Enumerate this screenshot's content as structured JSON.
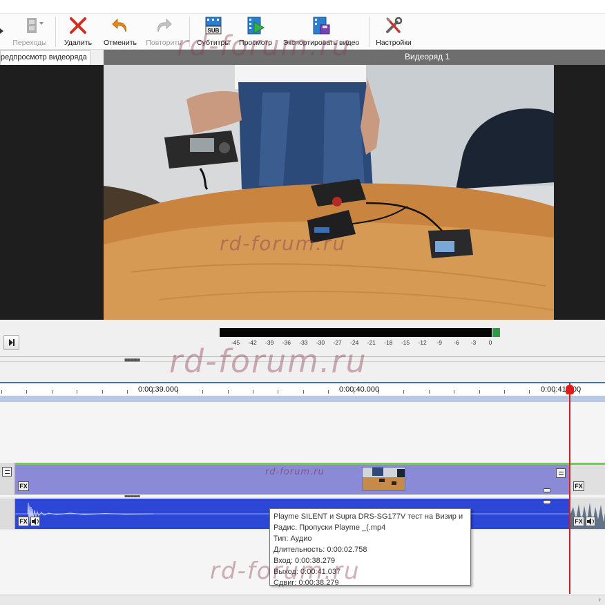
{
  "toolbar": {
    "transitions_label": "Переходы",
    "delete_label": "Удалить",
    "undo_label": "Отменить",
    "redo_label": "Повторить",
    "subtitles_label": "Субтитры",
    "subtitles_icon_text": "SUB",
    "preview_label": "Просмотр",
    "export_label": "Экспортировать видео",
    "settings_label": "Настройки"
  },
  "preview": {
    "tab_label": "редпросмотр видеоряда",
    "sequence_label": "Видеоряд 1"
  },
  "meter": {
    "ticks": [
      "-45",
      "-42",
      "-39",
      "-36",
      "-33",
      "-30",
      "-27",
      "-24",
      "-21",
      "-18",
      "-15",
      "-12",
      "-9",
      "-6",
      "-3",
      "0"
    ]
  },
  "timeline": {
    "ruler_labels": [
      "0:00:39.000",
      "0:00:40.000",
      "0:00:41.000"
    ],
    "video_clip_watermark": "rd-forum.ru",
    "fx_label": "FX"
  },
  "tooltip": {
    "line1": "Playme SILENT и Supra DRS-SG177V тест на Визир и",
    "line2": "Радис. Пропуски Playme _(.mp4",
    "type": "Тип: Аудио",
    "duration": "Длительность: 0:00:02.758",
    "in": "Вход: 0:00:38.279",
    "out": "Выход: 0:00:41.037",
    "offset": "Сдвиг: 0:00:38.279"
  },
  "watermark": {
    "text": "rd-forum.ru"
  },
  "colors": {
    "accent": "#3d6fbf",
    "video_clip": "#8a8ad6",
    "audio_clip": "#2c46d6",
    "playhead": "#d81c1c",
    "meter_peak": "#2e9a46"
  }
}
